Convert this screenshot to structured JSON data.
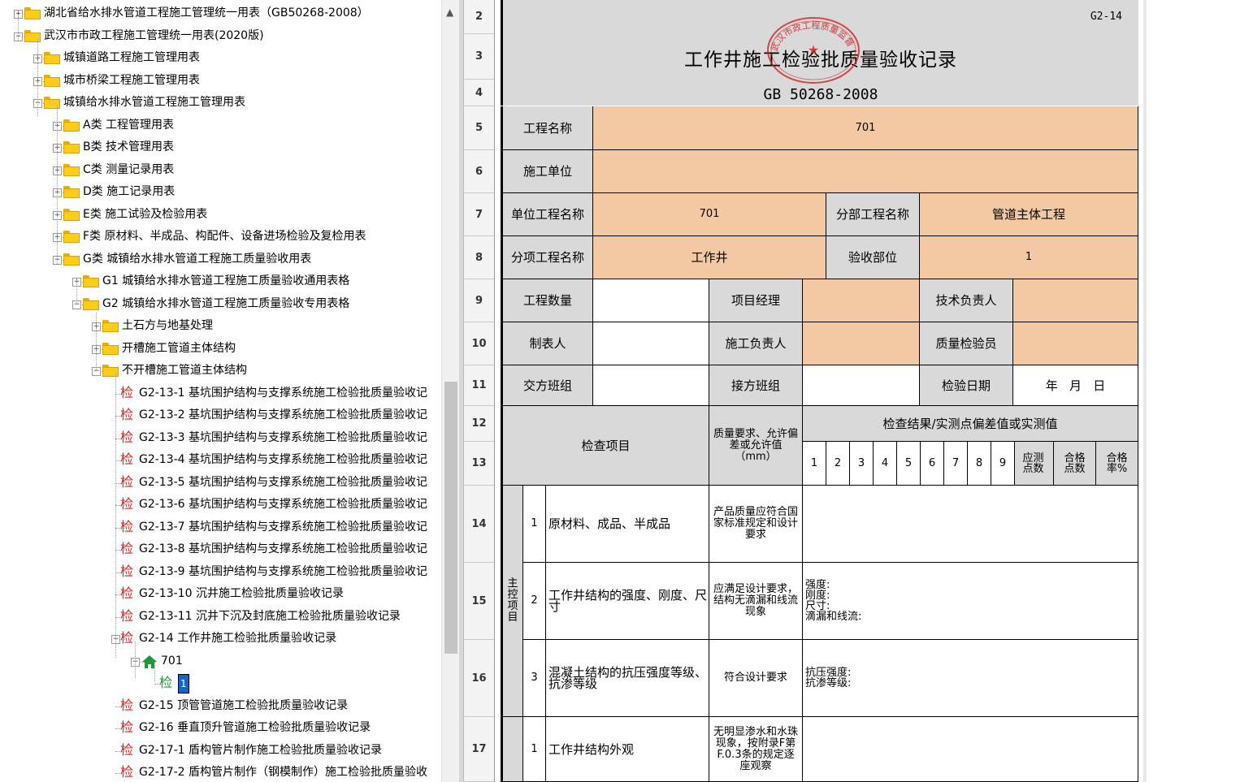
{
  "tree": {
    "nodes": [
      {
        "label": "湖北省给水排水管道工程施工管理统一用表（GB50268-2008）",
        "icon": "folder-icon",
        "state": "collapsed"
      },
      {
        "label": "武汉市市政工程施工管理统一用表(2020版)",
        "icon": "folder-open-icon",
        "state": "expanded"
      },
      {
        "label": "城镇道路工程施工管理用表",
        "icon": "folder-icon",
        "state": "collapsed"
      },
      {
        "label": "城市桥梁工程施工管理用表",
        "icon": "folder-icon",
        "state": "collapsed"
      },
      {
        "label": "城镇给水排水管道工程施工管理用表",
        "icon": "folder-open-icon",
        "state": "expanded"
      },
      {
        "label": "A类  工程管理用表",
        "icon": "folder-icon",
        "state": "collapsed"
      },
      {
        "label": "B类  技术管理用表",
        "icon": "folder-icon",
        "state": "collapsed"
      },
      {
        "label": "C类  测量记录用表",
        "icon": "folder-icon",
        "state": "collapsed"
      },
      {
        "label": "D类  施工记录用表",
        "icon": "folder-icon",
        "state": "collapsed"
      },
      {
        "label": "E类  施工试验及检验用表",
        "icon": "folder-icon",
        "state": "collapsed"
      },
      {
        "label": "F类  原材料、半成品、构配件、设备进场检验及复检用表",
        "icon": "folder-icon",
        "state": "collapsed"
      },
      {
        "label": "G类  城镇给水排水管道工程施工质量验收用表",
        "icon": "folder-open-icon",
        "state": "expanded"
      },
      {
        "label": "G1  城镇给水排水管道工程施工质量验收通用表格",
        "icon": "folder-icon",
        "state": "collapsed"
      },
      {
        "label": "G2  城镇给水排水管道工程施工质量验收专用表格",
        "icon": "folder-open-icon",
        "state": "expanded"
      },
      {
        "label": "土石方与地基处理",
        "icon": "folder-icon",
        "state": "collapsed"
      },
      {
        "label": "开槽施工管道主体结构",
        "icon": "folder-icon",
        "state": "collapsed"
      },
      {
        "label": "不开槽施工管道主体结构",
        "icon": "folder-open-icon",
        "state": "expanded"
      },
      {
        "label": "G2-13-1  基坑围护结构与支撑系统施工检验批质量验收记",
        "icon": "jian-icon"
      },
      {
        "label": "G2-13-2  基坑围护结构与支撑系统施工检验批质量验收记",
        "icon": "jian-icon"
      },
      {
        "label": "G2-13-3  基坑围护结构与支撑系统施工检验批质量验收记",
        "icon": "jian-icon"
      },
      {
        "label": "G2-13-4  基坑围护结构与支撑系统施工检验批质量验收记",
        "icon": "jian-icon"
      },
      {
        "label": "G2-13-5  基坑围护结构与支撑系统施工检验批质量验收记",
        "icon": "jian-icon"
      },
      {
        "label": "G2-13-6  基坑围护结构与支撑系统施工检验批质量验收记",
        "icon": "jian-icon"
      },
      {
        "label": "G2-13-7  基坑围护结构与支撑系统施工检验批质量验收记",
        "icon": "jian-icon"
      },
      {
        "label": "G2-13-8  基坑围护结构与支撑系统施工检验批质量验收记",
        "icon": "jian-icon"
      },
      {
        "label": "G2-13-9  基坑围护结构与支撑系统施工检验批质量验收记",
        "icon": "jian-icon"
      },
      {
        "label": "G2-13-10  沉井施工检验批质量验收记录",
        "icon": "jian-icon"
      },
      {
        "label": "G2-13-11  沉井下沉及封底施工检验批质量验收记录",
        "icon": "jian-icon"
      },
      {
        "label": "G2-14  工作井施工检验批质量验收记录",
        "icon": "jian-icon",
        "state": "expanded"
      },
      {
        "label": "701",
        "icon": "house-icon",
        "state": "expanded"
      },
      {
        "label": "1",
        "icon": "jian-green-icon",
        "selected": true
      },
      {
        "label": "G2-15  顶管管道施工检验批质量验收记录",
        "icon": "jian-icon"
      },
      {
        "label": "G2-16  垂直顶升管道施工检验批质量验收记录",
        "icon": "jian-icon"
      },
      {
        "label": "G2-17-1  盾构管片制作施工检验批质量验收记录",
        "icon": "jian-icon"
      },
      {
        "label": "G2-17-2  盾构管片制作（钢模制作）施工检验批质量验收",
        "icon": "jian-icon"
      }
    ],
    "jian_char": "检",
    "expand_plus": "+",
    "expand_minus": "−"
  },
  "sheet": {
    "row_numbers": [
      "2",
      "3",
      "4",
      "5",
      "6",
      "7",
      "8",
      "9",
      "10",
      "11",
      "12",
      "13",
      "14",
      "15",
      "16",
      "17"
    ],
    "form_code": "G2-14",
    "form_title": "工作井施工检验批质量验收记录",
    "standard": "GB 50268-2008",
    "stamp": {
      "text": "武汉市政工程质量监督",
      "color": "#cc2222"
    },
    "labels": {
      "project_name": "工程名称",
      "construction_unit": "施工单位",
      "unit_project_name": "单位工程名称",
      "division_name": "分部工程名称",
      "subitem_name": "分项工程名称",
      "acceptance_part": "验收部位",
      "quantity": "工程数量",
      "project_manager": "项目经理",
      "tech_leader": "技术负责人",
      "tabulator": "制表人",
      "construction_leader": "施工负责人",
      "quality_inspector": "质量检验员",
      "handover_shift": "交方班组",
      "takeover_shift": "接方班组",
      "inspection_date": "检验日期",
      "inspection_item": "检查项目",
      "quality_req": "质量要求、允许偏差或允许值（mm）",
      "check_results": "检查结果/实测点偏差值或实测值",
      "should_points": "应测点数",
      "pass_points": "合格点数",
      "pass_rate": "合格率%",
      "main_control": "主控项目"
    },
    "values": {
      "project_name": "701",
      "construction_unit": "",
      "unit_project_name": "701",
      "division_name": "管道主体工程",
      "subitem_name": "工作井",
      "acceptance_part": "1",
      "date_text": "年   月   日"
    },
    "point_numbers": [
      "1",
      "2",
      "3",
      "4",
      "5",
      "6",
      "7",
      "8",
      "9"
    ],
    "items": [
      {
        "no": "1",
        "name": "原材料、成品、半成品",
        "req": "产品质量应符合国家标准规定和设计要求",
        "result": []
      },
      {
        "no": "2",
        "name": "工作井结构的强度、刚度、尺寸",
        "req": "应满足设计要求，结构无滴漏和线流现象",
        "result": [
          "强度:",
          "刚度:",
          "尺寸:",
          "滴漏和线流:"
        ]
      },
      {
        "no": "3",
        "name": "混凝土结构的抗压强度等级、抗渗等级",
        "req": "符合设计要求",
        "result": [
          "抗压强度:",
          "抗渗等级:"
        ]
      },
      {
        "no": "1",
        "name": "工作井结构外观",
        "req": "无明显渗水和水珠现象，按附录F第F.0.3条的规定逐座观察",
        "result": []
      }
    ]
  }
}
